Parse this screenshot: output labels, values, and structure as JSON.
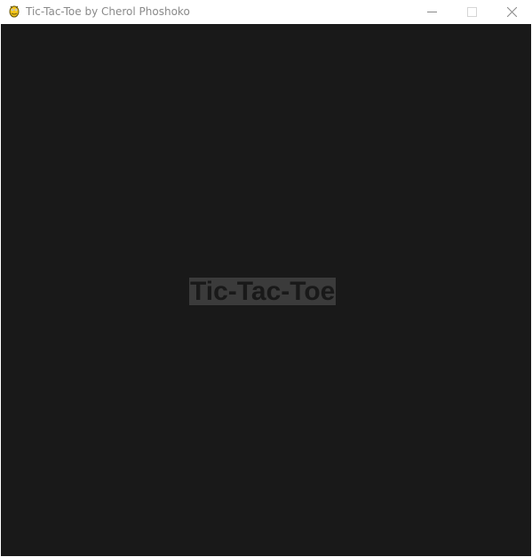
{
  "window": {
    "title": "Tic-Tac-Toe by Cherol Phoshoko",
    "icon": "pygame-snake-icon",
    "controls": {
      "minimize_icon": "minimize-icon",
      "maximize_icon": "maximize-icon",
      "close_icon": "close-icon"
    }
  },
  "game": {
    "splash_title": "Tic-Tac-Toe",
    "background_color": "#191919",
    "title_bg_color": "#3b3b3b",
    "title_text_color": "#191919"
  }
}
